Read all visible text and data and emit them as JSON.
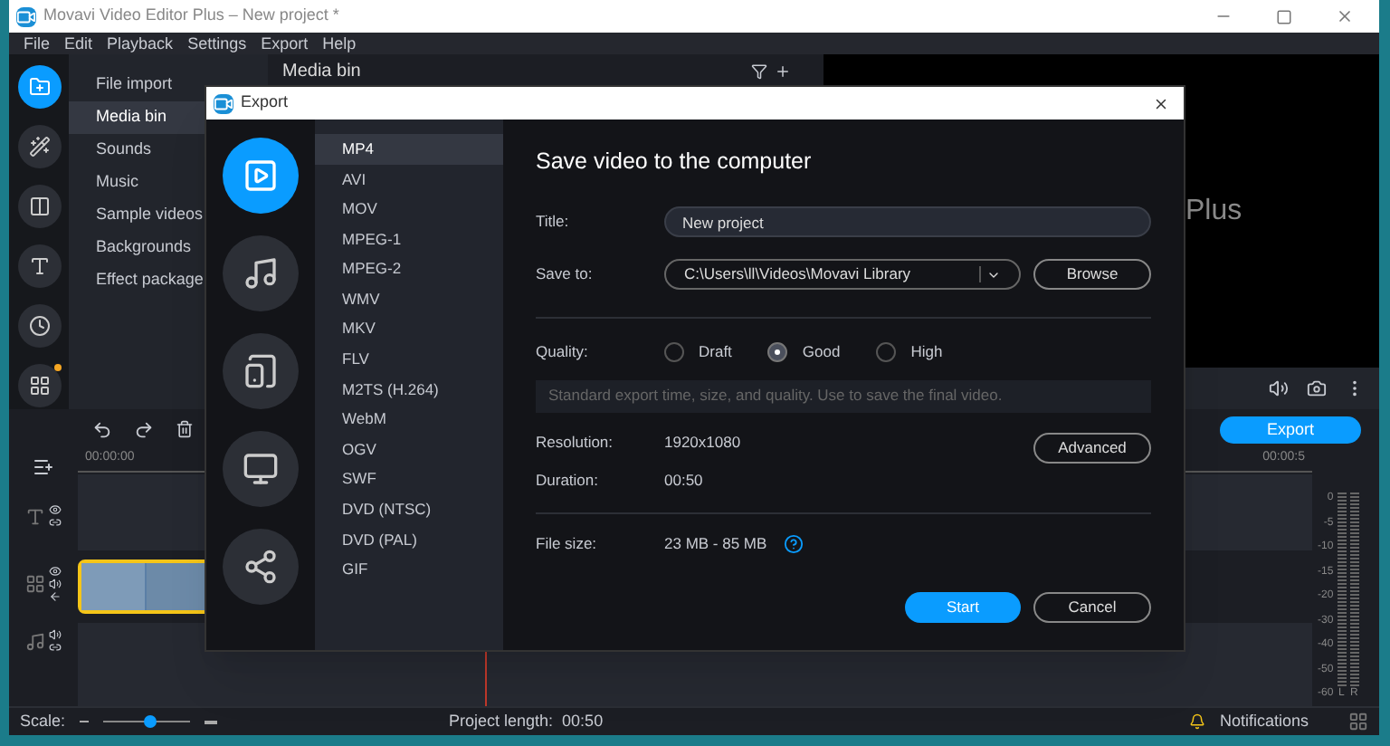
{
  "window": {
    "title": "Movavi Video Editor Plus – New project *"
  },
  "menu": [
    "File",
    "Edit",
    "Playback",
    "Settings",
    "Export",
    "Help"
  ],
  "tool_rail": [
    {
      "kind": "import",
      "selected": true,
      "dot": false
    },
    {
      "kind": "filters",
      "selected": false,
      "dot": false
    },
    {
      "kind": "transitions",
      "selected": false,
      "dot": false
    },
    {
      "kind": "titles",
      "selected": false,
      "dot": false
    },
    {
      "kind": "stickers",
      "selected": false,
      "dot": false
    },
    {
      "kind": "more",
      "selected": false,
      "dot": true
    }
  ],
  "sidebar": {
    "items": [
      {
        "label": "File import",
        "selected": false
      },
      {
        "label": "Media bin",
        "selected": true
      },
      {
        "label": "Sounds",
        "selected": false
      },
      {
        "label": "Music",
        "selected": false
      },
      {
        "label": "Sample videos",
        "selected": false
      },
      {
        "label": "Backgrounds",
        "selected": false
      },
      {
        "label": "Effect package",
        "selected": false
      }
    ]
  },
  "media_bin": {
    "title": "Media bin"
  },
  "preview": {
    "text": "Plus"
  },
  "timeline": {
    "export_button": "Export",
    "ruler": [
      "00:00:00",
      "00:00:5"
    ]
  },
  "level_meter": {
    "scale": [
      "0",
      "-5",
      "-10",
      "-15",
      "-20",
      "-30",
      "-40",
      "-50",
      "-60"
    ],
    "channels": [
      "L",
      "R"
    ]
  },
  "status_bar": {
    "scale_label": "Scale:",
    "zoom": {
      "level": 0.55
    },
    "project_length": "Project length:  00:50",
    "notifications": "Notifications"
  },
  "dialog": {
    "title": "Export",
    "categories": [
      {
        "kind": "video",
        "selected": true
      },
      {
        "kind": "audio",
        "selected": false
      },
      {
        "kind": "devices",
        "selected": false
      },
      {
        "kind": "tv",
        "selected": false
      },
      {
        "kind": "share",
        "selected": false
      }
    ],
    "formats": [
      {
        "label": "MP4",
        "selected": true
      },
      {
        "label": "AVI",
        "selected": false
      },
      {
        "label": "MOV",
        "selected": false
      },
      {
        "label": "MPEG-1",
        "selected": false
      },
      {
        "label": "MPEG-2",
        "selected": false
      },
      {
        "label": "WMV",
        "selected": false
      },
      {
        "label": "MKV",
        "selected": false
      },
      {
        "label": "FLV",
        "selected": false
      },
      {
        "label": "M2TS (H.264)",
        "selected": false
      },
      {
        "label": "WebM",
        "selected": false
      },
      {
        "label": "OGV",
        "selected": false
      },
      {
        "label": "SWF",
        "selected": false
      },
      {
        "label": "DVD (NTSC)",
        "selected": false
      },
      {
        "label": "DVD (PAL)",
        "selected": false
      },
      {
        "label": "GIF",
        "selected": false
      }
    ],
    "heading": "Save video to the computer",
    "title_label": "Title:",
    "title_value": "New project",
    "save_to_label": "Save to:",
    "save_to_value": "C:\\Users\\ll\\Videos\\Movavi Library",
    "browse": "Browse",
    "quality_label": "Quality:",
    "quality_options": [
      {
        "label": "Draft",
        "selected": false
      },
      {
        "label": "Good",
        "selected": true
      },
      {
        "label": "High",
        "selected": false
      }
    ],
    "description": "Standard export time, size, and quality. Use to save the final video.",
    "resolution_label": "Resolution:",
    "resolution": "1920x1080",
    "advanced": "Advanced",
    "duration_label": "Duration:",
    "duration": "00:50",
    "file_size_label": "File size:",
    "file_size": "23 MB - 85 MB",
    "start": "Start",
    "cancel": "Cancel"
  }
}
